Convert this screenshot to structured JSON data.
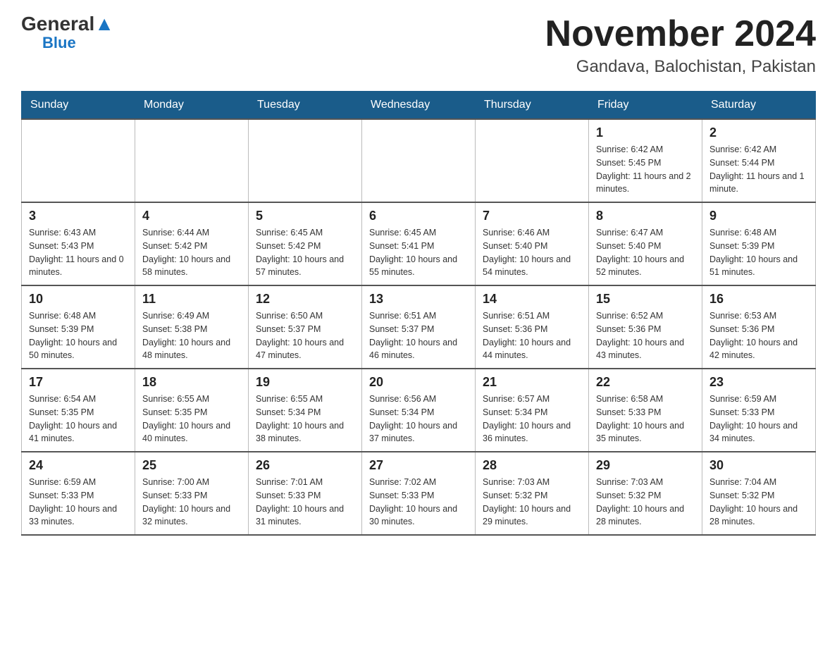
{
  "header": {
    "logo_general": "General",
    "logo_blue": "Blue",
    "month_title": "November 2024",
    "location": "Gandava, Balochistan, Pakistan"
  },
  "days_of_week": [
    "Sunday",
    "Monday",
    "Tuesday",
    "Wednesday",
    "Thursday",
    "Friday",
    "Saturday"
  ],
  "weeks": [
    [
      {
        "day": "",
        "sunrise": "",
        "sunset": "",
        "daylight": ""
      },
      {
        "day": "",
        "sunrise": "",
        "sunset": "",
        "daylight": ""
      },
      {
        "day": "",
        "sunrise": "",
        "sunset": "",
        "daylight": ""
      },
      {
        "day": "",
        "sunrise": "",
        "sunset": "",
        "daylight": ""
      },
      {
        "day": "",
        "sunrise": "",
        "sunset": "",
        "daylight": ""
      },
      {
        "day": "1",
        "sunrise": "Sunrise: 6:42 AM",
        "sunset": "Sunset: 5:45 PM",
        "daylight": "Daylight: 11 hours and 2 minutes."
      },
      {
        "day": "2",
        "sunrise": "Sunrise: 6:42 AM",
        "sunset": "Sunset: 5:44 PM",
        "daylight": "Daylight: 11 hours and 1 minute."
      }
    ],
    [
      {
        "day": "3",
        "sunrise": "Sunrise: 6:43 AM",
        "sunset": "Sunset: 5:43 PM",
        "daylight": "Daylight: 11 hours and 0 minutes."
      },
      {
        "day": "4",
        "sunrise": "Sunrise: 6:44 AM",
        "sunset": "Sunset: 5:42 PM",
        "daylight": "Daylight: 10 hours and 58 minutes."
      },
      {
        "day": "5",
        "sunrise": "Sunrise: 6:45 AM",
        "sunset": "Sunset: 5:42 PM",
        "daylight": "Daylight: 10 hours and 57 minutes."
      },
      {
        "day": "6",
        "sunrise": "Sunrise: 6:45 AM",
        "sunset": "Sunset: 5:41 PM",
        "daylight": "Daylight: 10 hours and 55 minutes."
      },
      {
        "day": "7",
        "sunrise": "Sunrise: 6:46 AM",
        "sunset": "Sunset: 5:40 PM",
        "daylight": "Daylight: 10 hours and 54 minutes."
      },
      {
        "day": "8",
        "sunrise": "Sunrise: 6:47 AM",
        "sunset": "Sunset: 5:40 PM",
        "daylight": "Daylight: 10 hours and 52 minutes."
      },
      {
        "day": "9",
        "sunrise": "Sunrise: 6:48 AM",
        "sunset": "Sunset: 5:39 PM",
        "daylight": "Daylight: 10 hours and 51 minutes."
      }
    ],
    [
      {
        "day": "10",
        "sunrise": "Sunrise: 6:48 AM",
        "sunset": "Sunset: 5:39 PM",
        "daylight": "Daylight: 10 hours and 50 minutes."
      },
      {
        "day": "11",
        "sunrise": "Sunrise: 6:49 AM",
        "sunset": "Sunset: 5:38 PM",
        "daylight": "Daylight: 10 hours and 48 minutes."
      },
      {
        "day": "12",
        "sunrise": "Sunrise: 6:50 AM",
        "sunset": "Sunset: 5:37 PM",
        "daylight": "Daylight: 10 hours and 47 minutes."
      },
      {
        "day": "13",
        "sunrise": "Sunrise: 6:51 AM",
        "sunset": "Sunset: 5:37 PM",
        "daylight": "Daylight: 10 hours and 46 minutes."
      },
      {
        "day": "14",
        "sunrise": "Sunrise: 6:51 AM",
        "sunset": "Sunset: 5:36 PM",
        "daylight": "Daylight: 10 hours and 44 minutes."
      },
      {
        "day": "15",
        "sunrise": "Sunrise: 6:52 AM",
        "sunset": "Sunset: 5:36 PM",
        "daylight": "Daylight: 10 hours and 43 minutes."
      },
      {
        "day": "16",
        "sunrise": "Sunrise: 6:53 AM",
        "sunset": "Sunset: 5:36 PM",
        "daylight": "Daylight: 10 hours and 42 minutes."
      }
    ],
    [
      {
        "day": "17",
        "sunrise": "Sunrise: 6:54 AM",
        "sunset": "Sunset: 5:35 PM",
        "daylight": "Daylight: 10 hours and 41 minutes."
      },
      {
        "day": "18",
        "sunrise": "Sunrise: 6:55 AM",
        "sunset": "Sunset: 5:35 PM",
        "daylight": "Daylight: 10 hours and 40 minutes."
      },
      {
        "day": "19",
        "sunrise": "Sunrise: 6:55 AM",
        "sunset": "Sunset: 5:34 PM",
        "daylight": "Daylight: 10 hours and 38 minutes."
      },
      {
        "day": "20",
        "sunrise": "Sunrise: 6:56 AM",
        "sunset": "Sunset: 5:34 PM",
        "daylight": "Daylight: 10 hours and 37 minutes."
      },
      {
        "day": "21",
        "sunrise": "Sunrise: 6:57 AM",
        "sunset": "Sunset: 5:34 PM",
        "daylight": "Daylight: 10 hours and 36 minutes."
      },
      {
        "day": "22",
        "sunrise": "Sunrise: 6:58 AM",
        "sunset": "Sunset: 5:33 PM",
        "daylight": "Daylight: 10 hours and 35 minutes."
      },
      {
        "day": "23",
        "sunrise": "Sunrise: 6:59 AM",
        "sunset": "Sunset: 5:33 PM",
        "daylight": "Daylight: 10 hours and 34 minutes."
      }
    ],
    [
      {
        "day": "24",
        "sunrise": "Sunrise: 6:59 AM",
        "sunset": "Sunset: 5:33 PM",
        "daylight": "Daylight: 10 hours and 33 minutes."
      },
      {
        "day": "25",
        "sunrise": "Sunrise: 7:00 AM",
        "sunset": "Sunset: 5:33 PM",
        "daylight": "Daylight: 10 hours and 32 minutes."
      },
      {
        "day": "26",
        "sunrise": "Sunrise: 7:01 AM",
        "sunset": "Sunset: 5:33 PM",
        "daylight": "Daylight: 10 hours and 31 minutes."
      },
      {
        "day": "27",
        "sunrise": "Sunrise: 7:02 AM",
        "sunset": "Sunset: 5:33 PM",
        "daylight": "Daylight: 10 hours and 30 minutes."
      },
      {
        "day": "28",
        "sunrise": "Sunrise: 7:03 AM",
        "sunset": "Sunset: 5:32 PM",
        "daylight": "Daylight: 10 hours and 29 minutes."
      },
      {
        "day": "29",
        "sunrise": "Sunrise: 7:03 AM",
        "sunset": "Sunset: 5:32 PM",
        "daylight": "Daylight: 10 hours and 28 minutes."
      },
      {
        "day": "30",
        "sunrise": "Sunrise: 7:04 AM",
        "sunset": "Sunset: 5:32 PM",
        "daylight": "Daylight: 10 hours and 28 minutes."
      }
    ]
  ]
}
